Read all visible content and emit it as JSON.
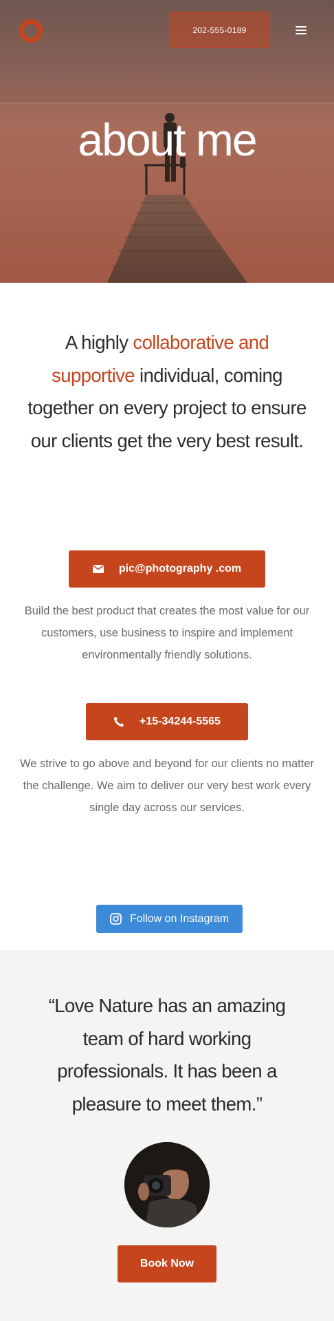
{
  "header": {
    "phone_label": "202-555-0189",
    "menu_icon": "hamburger-icon",
    "logo_icon": "ring-logo-icon"
  },
  "hero": {
    "title": "about me"
  },
  "intro": {
    "part1": "A highly ",
    "highlight": "collaborative and supportive",
    "part2": " individual, coming together on every project to ensure our clients get the very best result."
  },
  "contact": {
    "email_label": "pic@photography .com",
    "email_icon": "envelope-icon",
    "email_desc": "Build the best product that creates the most value for our customers, use business to inspire and implement environmentally friendly solutions.",
    "phone_label": "+15-34244-5565",
    "phone_icon": "phone-icon",
    "phone_desc": "We strive to go above and beyond for our clients no matter the challenge. We aim to deliver our very best work every single day across our services."
  },
  "instagram": {
    "label": "Follow on Instagram",
    "icon": "instagram-icon"
  },
  "testimonial": {
    "quote": "“Love Nature has an amazing team of hard working professionals. It has been a pleasure to meet them.”",
    "book_label": "Book Now"
  },
  "colors": {
    "accent": "#c5451d",
    "instagram_blue": "#3d8ad8",
    "testimonial_bg": "#f4f4f2"
  }
}
